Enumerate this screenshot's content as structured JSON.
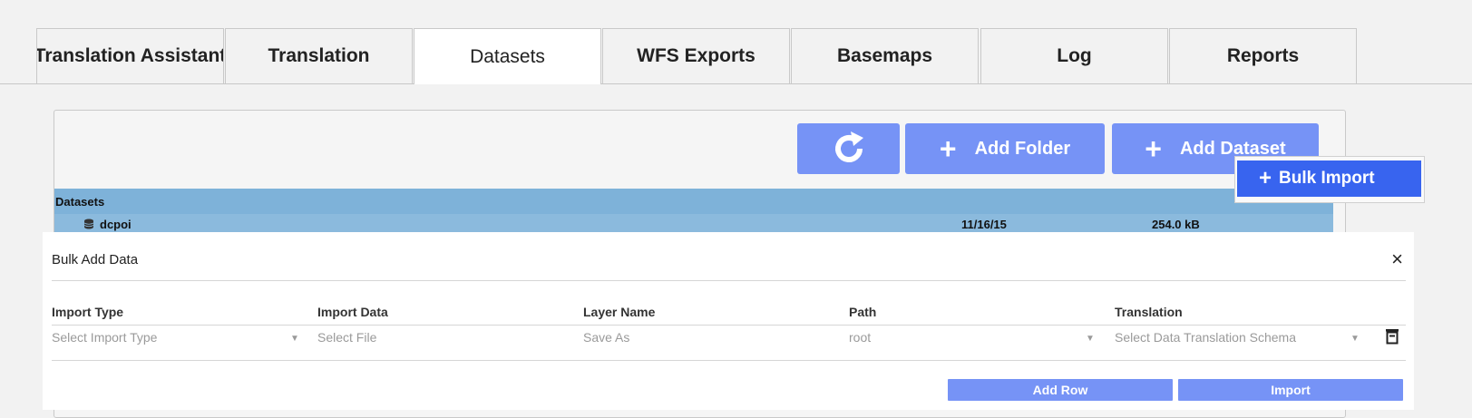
{
  "tabs": [
    {
      "label": "Translation Assistant",
      "active": false
    },
    {
      "label": "Translation",
      "active": false
    },
    {
      "label": "Datasets",
      "active": true
    },
    {
      "label": "WFS Exports",
      "active": false
    },
    {
      "label": "Basemaps",
      "active": false
    },
    {
      "label": "Log",
      "active": false
    },
    {
      "label": "Reports",
      "active": false
    }
  ],
  "toolbar": {
    "refresh_icon": "refresh-icon",
    "add_folder_label": "Add Folder",
    "add_dataset_label": "Add Dataset",
    "plus_glyph": "+"
  },
  "dropdown": {
    "bulk_import_label": "Bulk Import"
  },
  "datasets": {
    "header_label": "Datasets",
    "rows": [
      {
        "name": "dcpoi",
        "date": "11/16/15",
        "size": "254.0 kB",
        "icon": "database-icon"
      }
    ]
  },
  "modal": {
    "title": "Bulk Add Data",
    "close_glyph": "×",
    "columns": [
      "Import Type",
      "Import Data",
      "Layer Name",
      "Path",
      "Translation"
    ],
    "row": {
      "import_type_placeholder": "Select Import Type",
      "import_data_placeholder": "Select File",
      "layer_name_placeholder": "Save As",
      "path_value": "root",
      "translation_placeholder": "Select Data Translation Schema"
    },
    "add_row_label": "Add Row",
    "import_label": "Import"
  },
  "colors": {
    "button": "#7693f6",
    "menu_highlight": "#3864ef",
    "dataset_header": "#7eb2d9",
    "dataset_row": "#8bbadd"
  }
}
